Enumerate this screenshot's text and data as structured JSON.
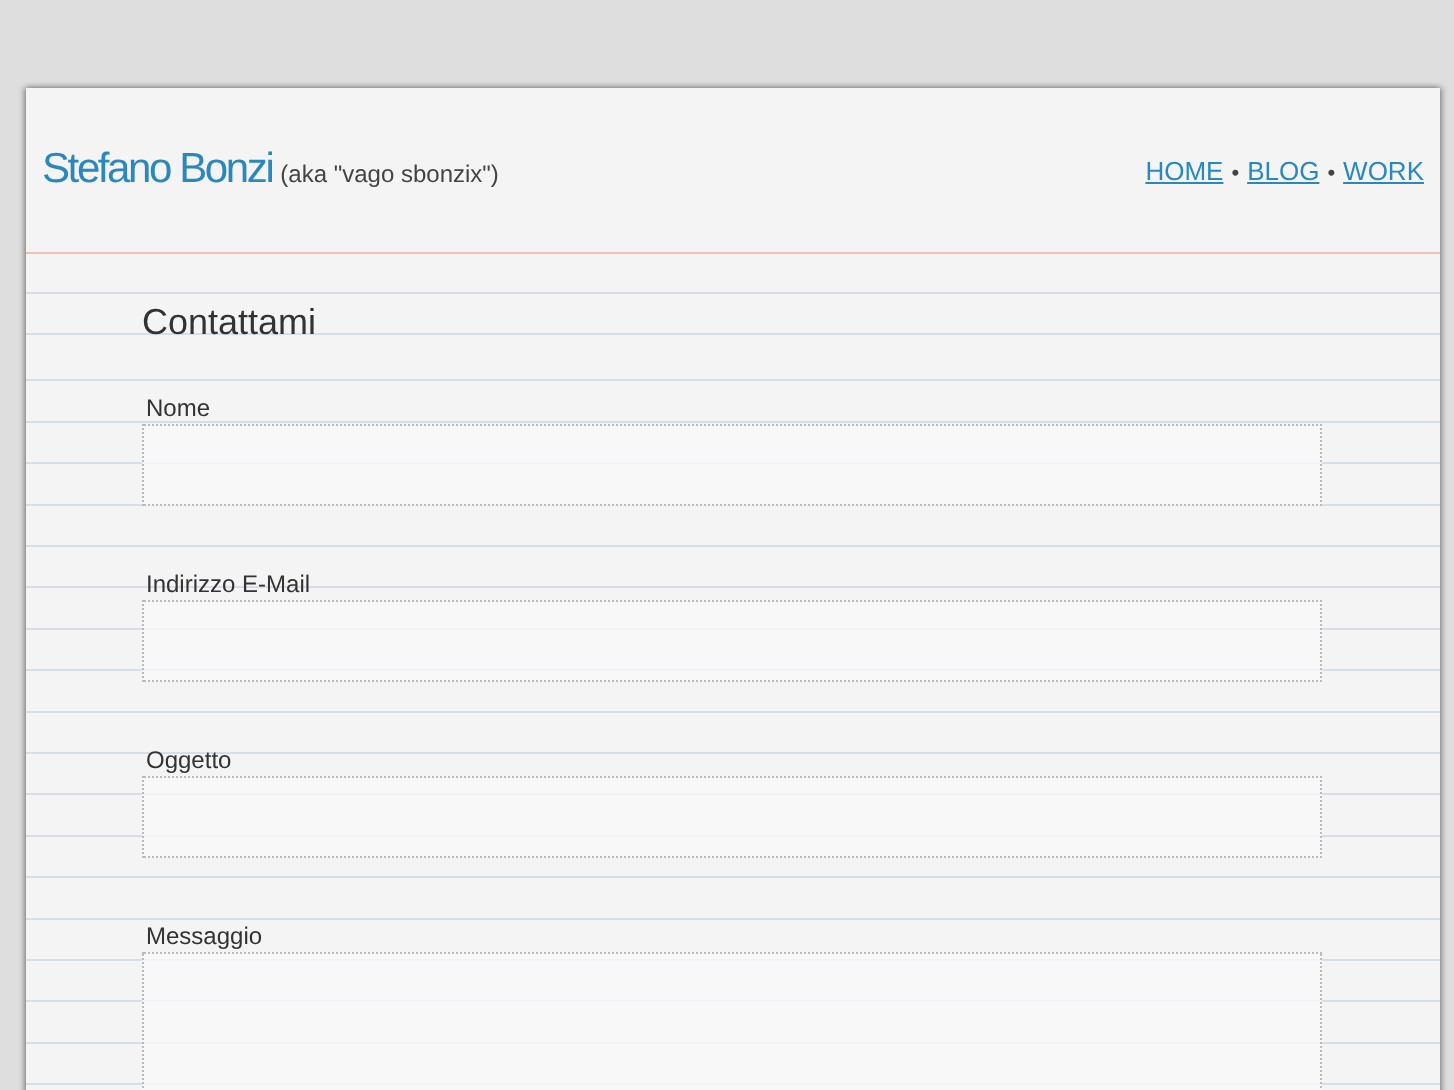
{
  "header": {
    "name": "Stefano Bonzi",
    "aka": "(aka \"vago sbonzix\")"
  },
  "nav": [
    {
      "kind": "link",
      "text": "HOME"
    },
    {
      "kind": "separator",
      "text": "•"
    },
    {
      "kind": "link",
      "text": "BLOG"
    },
    {
      "kind": "separator",
      "text": "•"
    },
    {
      "kind": "link",
      "text": "WORK"
    }
  ],
  "form": {
    "title": "Contattami",
    "fields": [
      {
        "label": "Nome",
        "kind": "input"
      },
      {
        "label": "Indirizzo E-Mail",
        "kind": "input"
      },
      {
        "label": "Oggetto",
        "kind": "input"
      },
      {
        "label": "Messaggio",
        "kind": "textarea"
      }
    ]
  }
}
